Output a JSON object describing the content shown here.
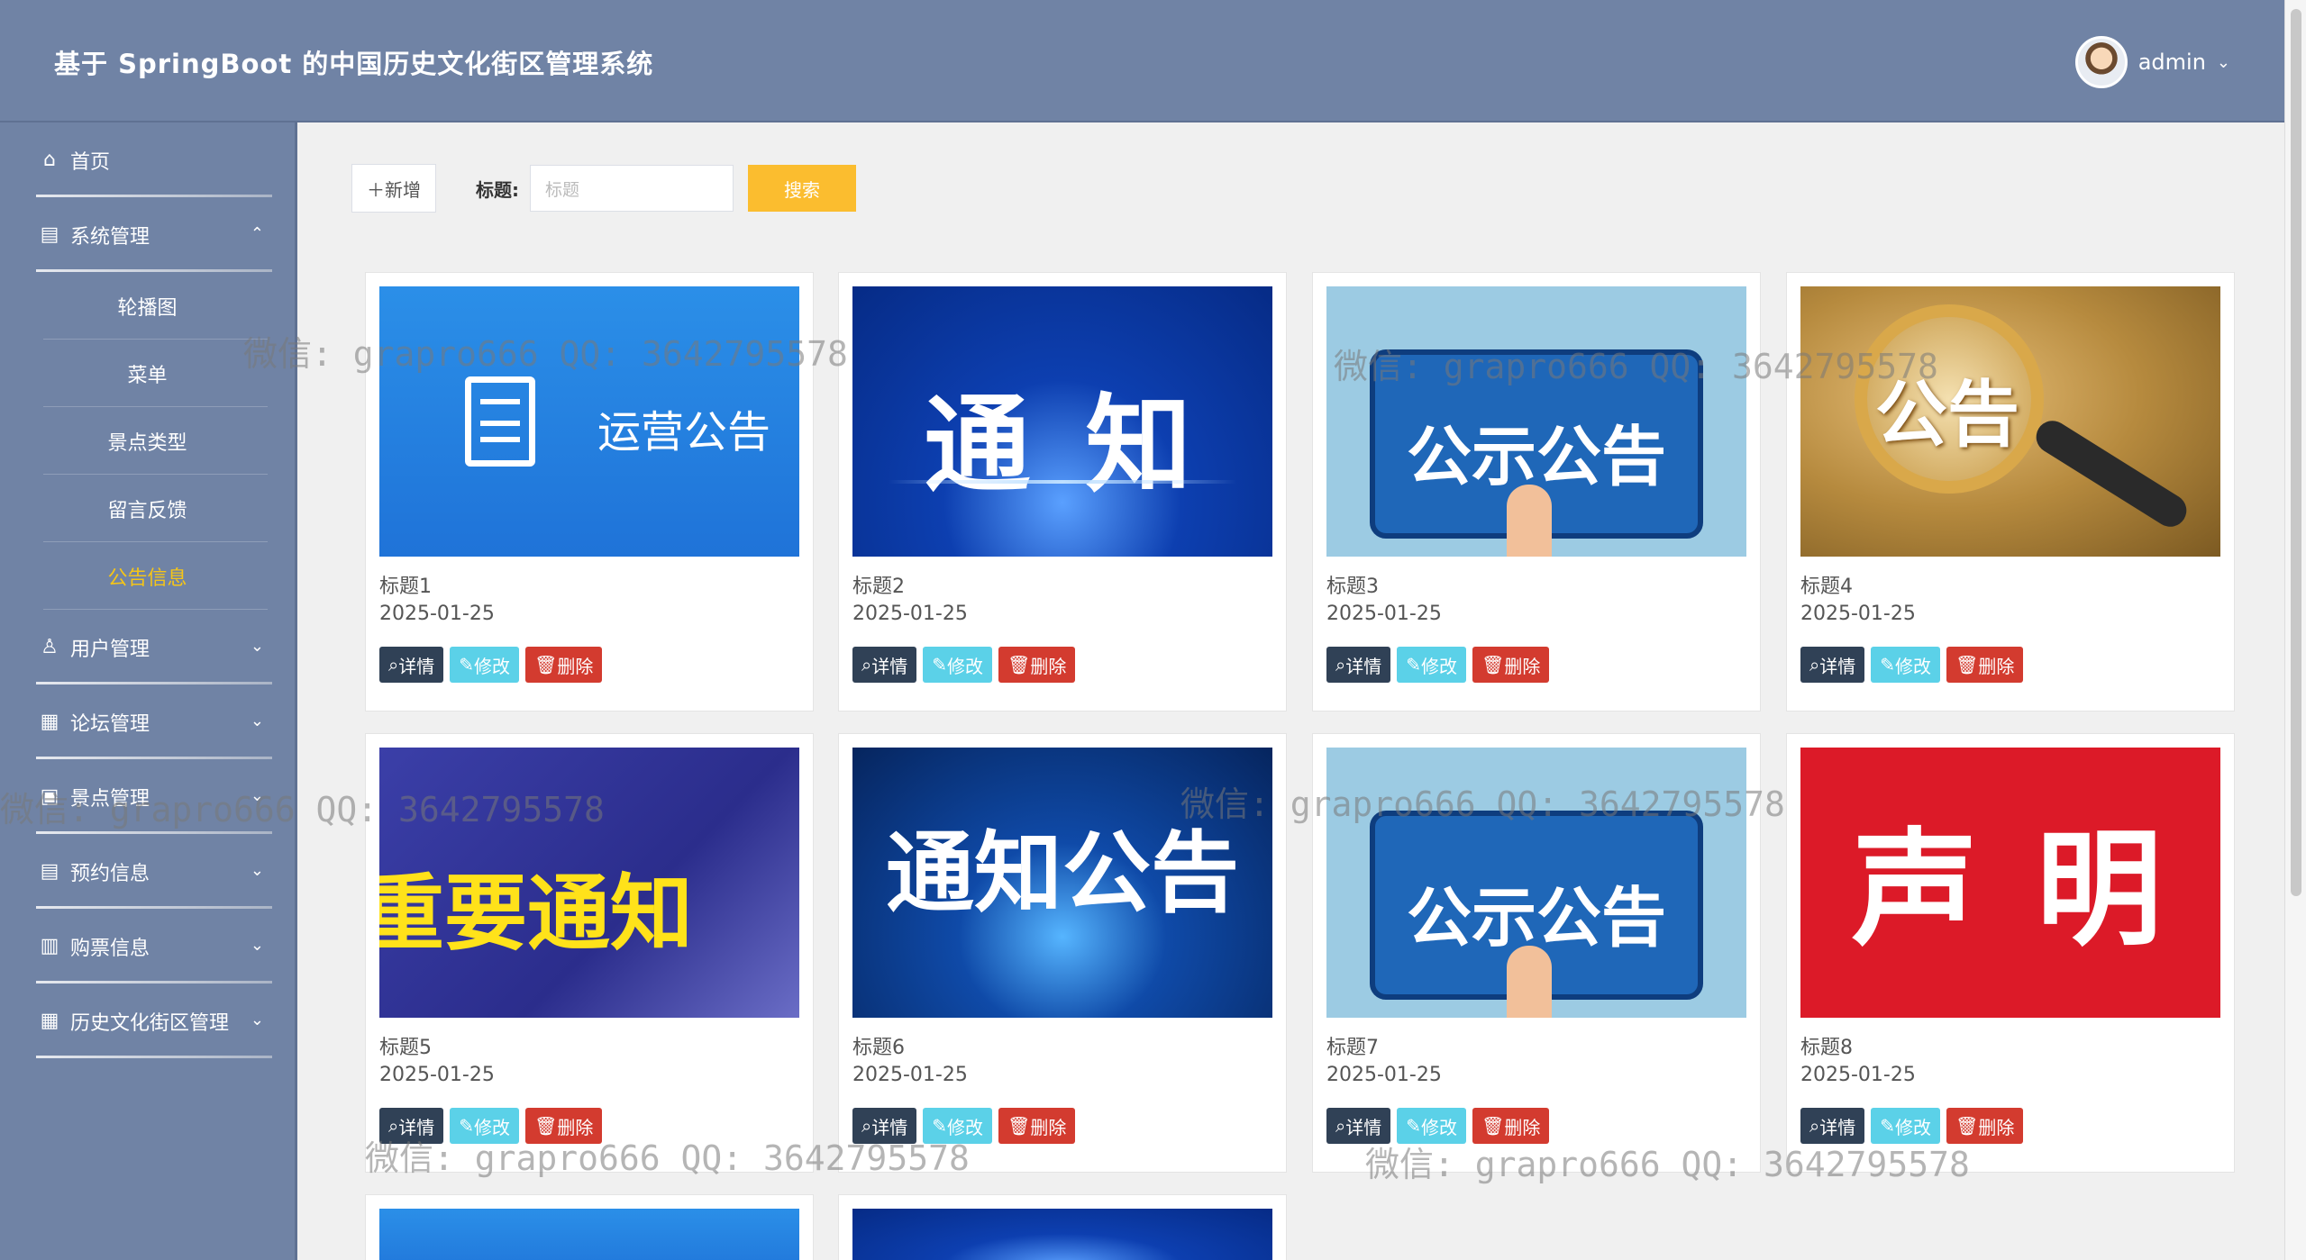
{
  "header": {
    "title": "基于 SpringBoot 的中国历史文化街区管理系统",
    "user": "admin"
  },
  "sidebar": {
    "items": [
      {
        "label": "首页",
        "icon": "home-icon"
      },
      {
        "label": "系统管理",
        "icon": "system-icon",
        "expanded": true,
        "children": [
          "轮播图",
          "菜单",
          "景点类型",
          "留言反馈",
          "公告信息"
        ]
      },
      {
        "label": "用户管理",
        "icon": "user-icon"
      },
      {
        "label": "论坛管理",
        "icon": "forum-icon"
      },
      {
        "label": "景点管理",
        "icon": "scenic-icon"
      },
      {
        "label": "预约信息",
        "icon": "booking-icon"
      },
      {
        "label": "购票信息",
        "icon": "ticket-icon"
      },
      {
        "label": "历史文化街区管理",
        "icon": "street-icon"
      }
    ],
    "active": "公告信息"
  },
  "toolbar": {
    "add_label": "新增",
    "search_label": "标题:",
    "search_placeholder": "标题",
    "search_button": "搜索"
  },
  "cards": [
    {
      "title": "标题1",
      "date": "2025-01-25",
      "image_text": "运营公告"
    },
    {
      "title": "标题2",
      "date": "2025-01-25",
      "image_text": "通  知"
    },
    {
      "title": "标题3",
      "date": "2025-01-25",
      "image_text": "公示公告"
    },
    {
      "title": "标题4",
      "date": "2025-01-25",
      "image_text": "公告"
    },
    {
      "title": "标题5",
      "date": "2025-01-25",
      "image_text": "重要通知"
    },
    {
      "title": "标题6",
      "date": "2025-01-25",
      "image_text": "通知公告"
    },
    {
      "title": "标题7",
      "date": "2025-01-25",
      "image_text": "公示公告"
    },
    {
      "title": "标题8",
      "date": "2025-01-25",
      "image_text": "声 明"
    }
  ],
  "actions": {
    "detail": "详情",
    "edit": "修改",
    "delete": "删除"
  },
  "watermark": "微信: grapro666 QQ: 3642795578",
  "colors": {
    "header": "#7083a5",
    "active": "#f5c518",
    "search": "#fbbd2f",
    "detail": "#304156",
    "edit": "#5bd1e8",
    "delete": "#d33b2f"
  }
}
